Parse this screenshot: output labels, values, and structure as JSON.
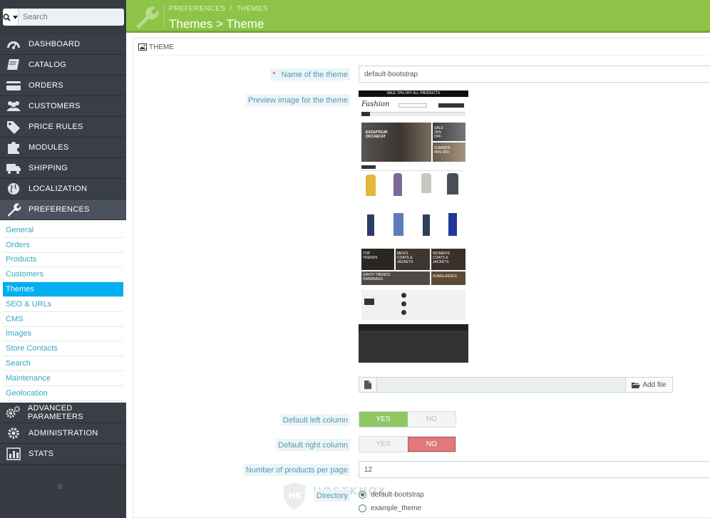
{
  "sidebar": {
    "search_placeholder": "Search",
    "menu": [
      {
        "label": "DASHBOARD",
        "icon": "dashboard-icon"
      },
      {
        "label": "CATALOG",
        "icon": "book-icon"
      },
      {
        "label": "ORDERS",
        "icon": "credit-card-icon"
      },
      {
        "label": "CUSTOMERS",
        "icon": "users-icon"
      },
      {
        "label": "PRICE RULES",
        "icon": "tags-icon"
      },
      {
        "label": "MODULES",
        "icon": "puzzle-icon"
      },
      {
        "label": "SHIPPING",
        "icon": "truck-icon"
      },
      {
        "label": "LOCALIZATION",
        "icon": "globe-icon"
      },
      {
        "label": "PREFERENCES",
        "icon": "wrench-icon"
      }
    ],
    "submenu": [
      "General",
      "Orders",
      "Products",
      "Customers",
      "Themes",
      "SEO & URLs",
      "CMS",
      "Images",
      "Store Contacts",
      "Search",
      "Maintenance",
      "Geolocation"
    ],
    "submenu_active": "Themes",
    "menu_after": [
      {
        "label": "ADVANCED PARAMETERS",
        "icon": "cogs-icon"
      },
      {
        "label": "ADMINISTRATION",
        "icon": "cog-icon"
      },
      {
        "label": "STATS",
        "icon": "bar-chart-icon"
      }
    ],
    "collapse_icon": "≡"
  },
  "header": {
    "breadcrumb_1": "PREFERENCES",
    "breadcrumb_sep": "/",
    "breadcrumb_2": "THEMES",
    "title": "Themes > Theme"
  },
  "panel": {
    "heading": "THEME",
    "required_mark": "*",
    "name_label": "Name of the theme",
    "name_value": "default-bootstrap",
    "preview_label": "Preview image for the theme",
    "preview_texts": {
      "sale": "SALE 70% OFF ALL PRODUCTS",
      "logo": "Fashion",
      "banner_1": "EXCEPTEUR OCCAECAT",
      "banner_2": "SALE 25% OFF",
      "banner_3": "SUMMER 45% OFF",
      "top_trends": "TOP TRENDS",
      "mens": "MEN'S COATS & JACKETS",
      "womens": "WOMEN'S COATS & JACKETS",
      "savvy": "SAVVY TRENDS HANDBAGS",
      "sunglasses": "SUNGLASSES"
    },
    "add_file_label": "Add file",
    "left_column_label": "Default left column",
    "left_column_value": "YES",
    "right_column_label": "Default right column",
    "right_column_value": "NO",
    "yes_label": "YES",
    "no_label": "NO",
    "products_label": "Number of products per page",
    "products_value": "12",
    "directory_label": "Directory",
    "directory_options": [
      "default-bootstrap",
      "example_theme"
    ],
    "directory_selected": "default-bootstrap"
  },
  "watermark": "HOSTKNOX",
  "colors": {
    "header_green": "#8dc447",
    "sidebar_dark": "#363a41",
    "active_blue": "#00aff0",
    "yes_green": "#8dc865",
    "no_red": "#e07a7a"
  }
}
